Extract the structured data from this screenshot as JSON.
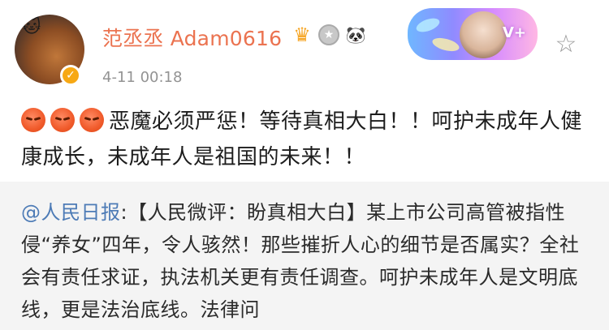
{
  "post": {
    "author_name": "范丞丞 Adam0616",
    "timestamp": "4-11 00:18",
    "avatar_icon": "cat-icon",
    "verified_icon": "verified-badge-icon",
    "badge_icons": [
      "crown-icon",
      "medal-icon",
      "panda-icon"
    ],
    "vip_label": "V+",
    "favorite_icon": "star-outline-icon",
    "emojis": [
      "angry-face-icon",
      "angry-face-icon",
      "angry-face-icon"
    ],
    "text": "恶魔必须严惩！等待真相大白！！呵护未成年人健康成长，未成年人是祖国的未来！！"
  },
  "repost": {
    "mention": "@人民日报",
    "text": ":【人民微评：盼真相大白】某上市公司高管被指性侵“养女”四年，令人骇然！那些摧折人心的细节是否属实？全社会有责任求证，执法机关更有责任调查。呵护未成年人是文明底线，更是法治底线。法律问"
  },
  "colors": {
    "username": "#eb7350",
    "timestamp": "#939393",
    "mention": "#4d7bb6",
    "repost_background": "#f4f4f4"
  }
}
